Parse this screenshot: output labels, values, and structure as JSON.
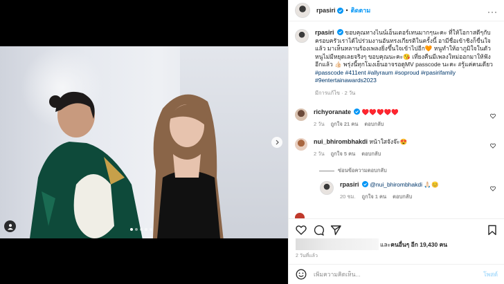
{
  "header": {
    "username": "rpasiri",
    "follow_label": "ติดตาม",
    "more_icon": "more-horizontal-icon"
  },
  "caption": {
    "username": "rpasiri",
    "text": "ขอบคุณทางไนน์เอ็นเตอร์เทนมากๆนะคะ ที่ให้โอกาสดีๆกับครอบครัวเราได้ไปร่วมงานอันทรงเกียรติในครั้งนี้ อามีชื่อเข้าชิงก็ขื่นใจแล้ว มาเห็นหลานร้องเพลงยิ่งขึ้นใจเข้าไปอีก🧡 หนูทำให้อาภูมิใจในตัวหนูไม่มีหยุดเลยจริงๆ ขอบคุณนะคะ😘 เที่ยงคืนมีเพลงใหม่ออกมาให้ฟังอีกแล้ว 👍🏻 พรุ่งนี้ทุกโมงเย็นอาจรอดูMV passcode นะคะ #รู้แค่คนเดียว",
    "hashtags": "#passcode #411ent #allyraum #soproud #rpasirifamily #9entertainawards2023",
    "time": "มีการแก้ไข · 2 วัน"
  },
  "comments": [
    {
      "username": "richyoranate",
      "text": "♥️♥️♥️♥️♥️",
      "time": "2 วัน",
      "likes": "ถูกใจ 21 คน",
      "reply": "ตอบกลับ"
    },
    {
      "username": "nui_bhirombhakdi",
      "text": "หน้าใสจังจ๊ะ😍",
      "time": "2 วัน",
      "likes": "ถูกใจ 5 คน",
      "reply": "ตอบกลับ"
    }
  ],
  "view_replies_label": "ซ่อนข้อความตอบกลับ",
  "reply": {
    "username": "rpasiri",
    "mention": "@nui_bhirombhakdi",
    "text": "🙏🏻😊",
    "time": "20 ชม.",
    "likes": "ถูกใจ 1 คน",
    "reply_label": "ตอบกลับ"
  },
  "likes": {
    "prefix": "และ",
    "text": "คนอื่นๆ อีก 19,430 คน"
  },
  "post_time": "2 วันที่แล้ว",
  "add_comment": {
    "placeholder": "เพิ่มความคิดเห็น...",
    "post_label": "โพสต์"
  },
  "carousel": {
    "count": 5,
    "active_index": 0
  },
  "colors": {
    "link_blue": "#0095f6",
    "heart_red": "#ed4956",
    "muted": "#8e8e8e"
  }
}
